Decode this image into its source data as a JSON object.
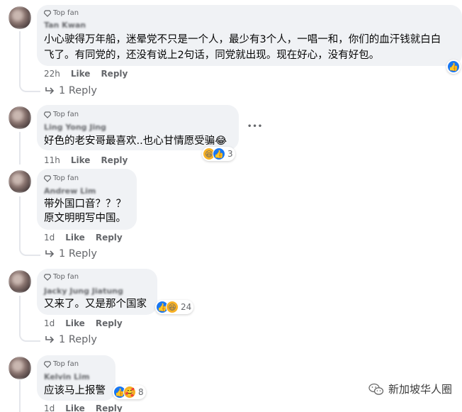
{
  "comments": [
    {
      "badge": "Top fan",
      "name": "Tan Kwan",
      "lines": [
        "小心驶得万年船，迷晕党不只是一个人，最少有3个人，一唱一和，你们的血汗钱就白白",
        "飞了。有同党的，还没有说上2句话，同党就出现。现在好心，没有好包。"
      ],
      "time": "22h",
      "like": "Like",
      "reply": "Reply",
      "reactions": {
        "types": [
          "like"
        ],
        "count": ""
      },
      "replies": "1 Reply"
    },
    {
      "badge": "Top fan",
      "name": "Ling Yong Jing",
      "lines": [
        "好色的老安哥最喜欢..也心甘情愿受骗😂"
      ],
      "time": "11h",
      "like": "Like",
      "reply": "Reply",
      "reactions": {
        "types": [
          "haha",
          "like"
        ],
        "count": "3"
      },
      "more": "•••"
    },
    {
      "badge": "Top fan",
      "name": "Andrew Lim",
      "lines": [
        "带外国口音？？？",
        "原文明明写中国。"
      ],
      "time": "1d",
      "like": "Like",
      "reply": "Reply",
      "replies": "1 Reply"
    },
    {
      "badge": "Top fan",
      "name": "Jacky Jung Jiatung",
      "lines": [
        "又来了。又是那个国家"
      ],
      "time": "1d",
      "like": "Like",
      "reply": "Reply",
      "reactions": {
        "types": [
          "like",
          "haha"
        ],
        "count": "24"
      },
      "replies": "1 Reply"
    },
    {
      "badge": "Top fan",
      "name": "Kelvin Lim",
      "lines": [
        "应该马上报警"
      ],
      "time": "1d",
      "like": "Like",
      "reply": "Reply",
      "reactions": {
        "types": [
          "like",
          "care"
        ],
        "count": "8"
      }
    }
  ],
  "watermark": "新加坡华人圈",
  "colors": {
    "bubble": "#f0f2f5",
    "meta": "#65676b",
    "like_blue": "#1877f2",
    "haha_yellow": "#f7b125"
  },
  "icons": [
    "top-fan-diamond-icon",
    "reply-arrow-icon",
    "like-reaction-icon",
    "haha-reaction-icon",
    "care-reaction-icon",
    "more-options-icon",
    "wechat-icon"
  ]
}
